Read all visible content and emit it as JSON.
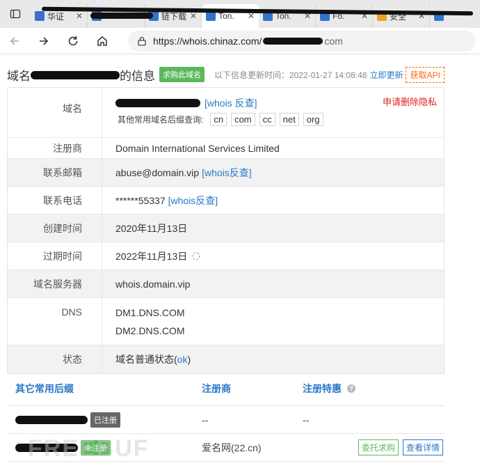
{
  "browser": {
    "tabs": [
      {
        "title": "华证",
        "color": "#3b6fd0"
      },
      {
        "title": "",
        "color": "#2f74d0"
      },
      {
        "title": "链下载",
        "color": "#2f74d0"
      },
      {
        "title": "Ton.",
        "color": "#2f74d0"
      },
      {
        "title": "Ton.",
        "color": "#2f74d0"
      },
      {
        "title": "Fo.",
        "color": "#2f74d0"
      },
      {
        "title": "安全",
        "color": "#f0a020"
      },
      {
        "title": "",
        "color": "#2f74d0"
      }
    ],
    "url": "https://whois.chinaz.com/",
    "url_suffix": "com"
  },
  "header": {
    "title_prefix": "域名",
    "title_suffix": "的信息",
    "buy_button": "求购此域名",
    "update_text": "以下信息更新时间：2022-01-27 14:08:48",
    "update_link": "立即更新",
    "api_button": "获取API"
  },
  "info": {
    "domain_label": "域名",
    "domain_reverse": "[whois 反查]",
    "privacy_link": "申请删除隐私",
    "other_suffix_label": "其他常用域名后缀查询:",
    "suffixes": [
      "cn",
      "com",
      "cc",
      "net",
      "org"
    ],
    "registrar_label": "注册商",
    "registrar": "Domain International Services Limited",
    "email_label": "联系邮箱",
    "email": "abuse@domain.vip",
    "email_reverse": "[whois反查]",
    "phone_label": "联系电话",
    "phone": "******55337",
    "phone_reverse": "[whois反查]",
    "created_label": "创建时间",
    "created": "2020年11月13日",
    "expires_label": "过期时间",
    "expires": "2022年11月13日",
    "ns_label": "域名服务器",
    "ns": "whois.domain.vip",
    "dns_label": "DNS",
    "dns1": "DM1.DNS.COM",
    "dns2": "DM2.DNS.COM",
    "status_label": "状态",
    "status_text": "域名普通状态(",
    "status_link": "ok",
    "status_close": ")"
  },
  "suffix_table": {
    "headers": [
      "其它常用后缀",
      "注册商",
      "注册特惠"
    ],
    "rows": [
      {
        "badge": "已注册",
        "registrar": "--",
        "offer": "--"
      },
      {
        "badge": "未注册",
        "registrar": "爱名网(22.cn)",
        "btn1": "委托求购",
        "btn2": "查看详情"
      }
    ]
  },
  "watermark": "FREEBUF"
}
